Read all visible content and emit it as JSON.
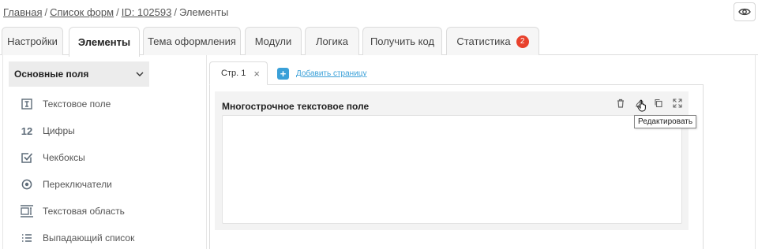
{
  "breadcrumb": {
    "home": "Главная",
    "forms": "Список форм",
    "id": "ID: 102593",
    "current": "Элементы",
    "separator": "/"
  },
  "header": {
    "preview_icon": "eye-icon"
  },
  "tabs": [
    {
      "label": "Настройки"
    },
    {
      "label": "Элементы"
    },
    {
      "label": "Тема оформления"
    },
    {
      "label": "Модули"
    },
    {
      "label": "Логика"
    },
    {
      "label": "Получить код"
    },
    {
      "label": "Статистика",
      "badge": "2"
    }
  ],
  "active_tab": "Элементы",
  "sidebar": {
    "section_title": "Основные поля",
    "items": [
      {
        "label": "Текстовое поле",
        "icon": "text-field-icon"
      },
      {
        "label": "Цифры",
        "icon": "numbers-icon",
        "glyph": "12"
      },
      {
        "label": "Чекбоксы",
        "icon": "checkbox-icon"
      },
      {
        "label": "Переключатели",
        "icon": "radio-icon"
      },
      {
        "label": "Текстовая область",
        "icon": "textarea-icon"
      },
      {
        "label": "Выпадающий список",
        "icon": "list-icon"
      }
    ]
  },
  "pages": {
    "current_tab": "Стр. 1",
    "close_glyph": "×",
    "add_label": "Добавить страницу",
    "add_glyph": "+"
  },
  "field": {
    "title": "Многострочное текстовое поле",
    "tooltip": "Редактировать",
    "actions": [
      "delete-icon",
      "edit-icon",
      "copy-icon",
      "expand-icon"
    ]
  },
  "colors": {
    "accent": "#3aa0d8",
    "badge": "#e8412c",
    "highlight": "#f5f21e"
  }
}
